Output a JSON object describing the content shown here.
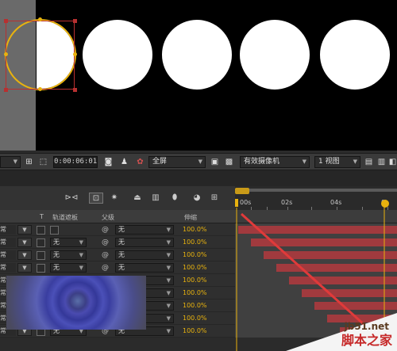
{
  "toolbar": {
    "timecode": "0:00:06:01",
    "resolution": "全屏",
    "camera": "有效摄像机",
    "views": "1 视图"
  },
  "ruler": {
    "labels": [
      "00s",
      "02s",
      "04s",
      "0"
    ]
  },
  "columns": {
    "t": "T",
    "track_matte": "轨道遮板",
    "parent": "父级",
    "stretch": "伸缩"
  },
  "rows": [
    {
      "mode": "常",
      "matte": "",
      "parent": "无",
      "stretch": "100.0%"
    },
    {
      "mode": "常",
      "matte": "无",
      "parent": "无",
      "stretch": "100.0%"
    },
    {
      "mode": "常",
      "matte": "无",
      "parent": "无",
      "stretch": "100.0%"
    },
    {
      "mode": "常",
      "matte": "无",
      "parent": "无",
      "stretch": "100.0%"
    },
    {
      "mode": "常",
      "matte": "无",
      "parent": "无",
      "stretch": "100.0%"
    },
    {
      "mode": "常",
      "matte": "无",
      "parent": "无",
      "stretch": "100.0%"
    },
    {
      "mode": "常",
      "matte": "无",
      "parent": "无",
      "stretch": "100.0%"
    },
    {
      "mode": "常",
      "matte": "无",
      "parent": "无",
      "stretch": "100.0%"
    },
    {
      "mode": "常",
      "matte": "无",
      "parent": "无",
      "stretch": "100.0%"
    }
  ],
  "watermark": {
    "url": "jb51.net",
    "name": "脚本之家"
  },
  "colors": {
    "bar": "#a13a3e",
    "accent": "#e8b20e",
    "selection": "#b73030"
  }
}
